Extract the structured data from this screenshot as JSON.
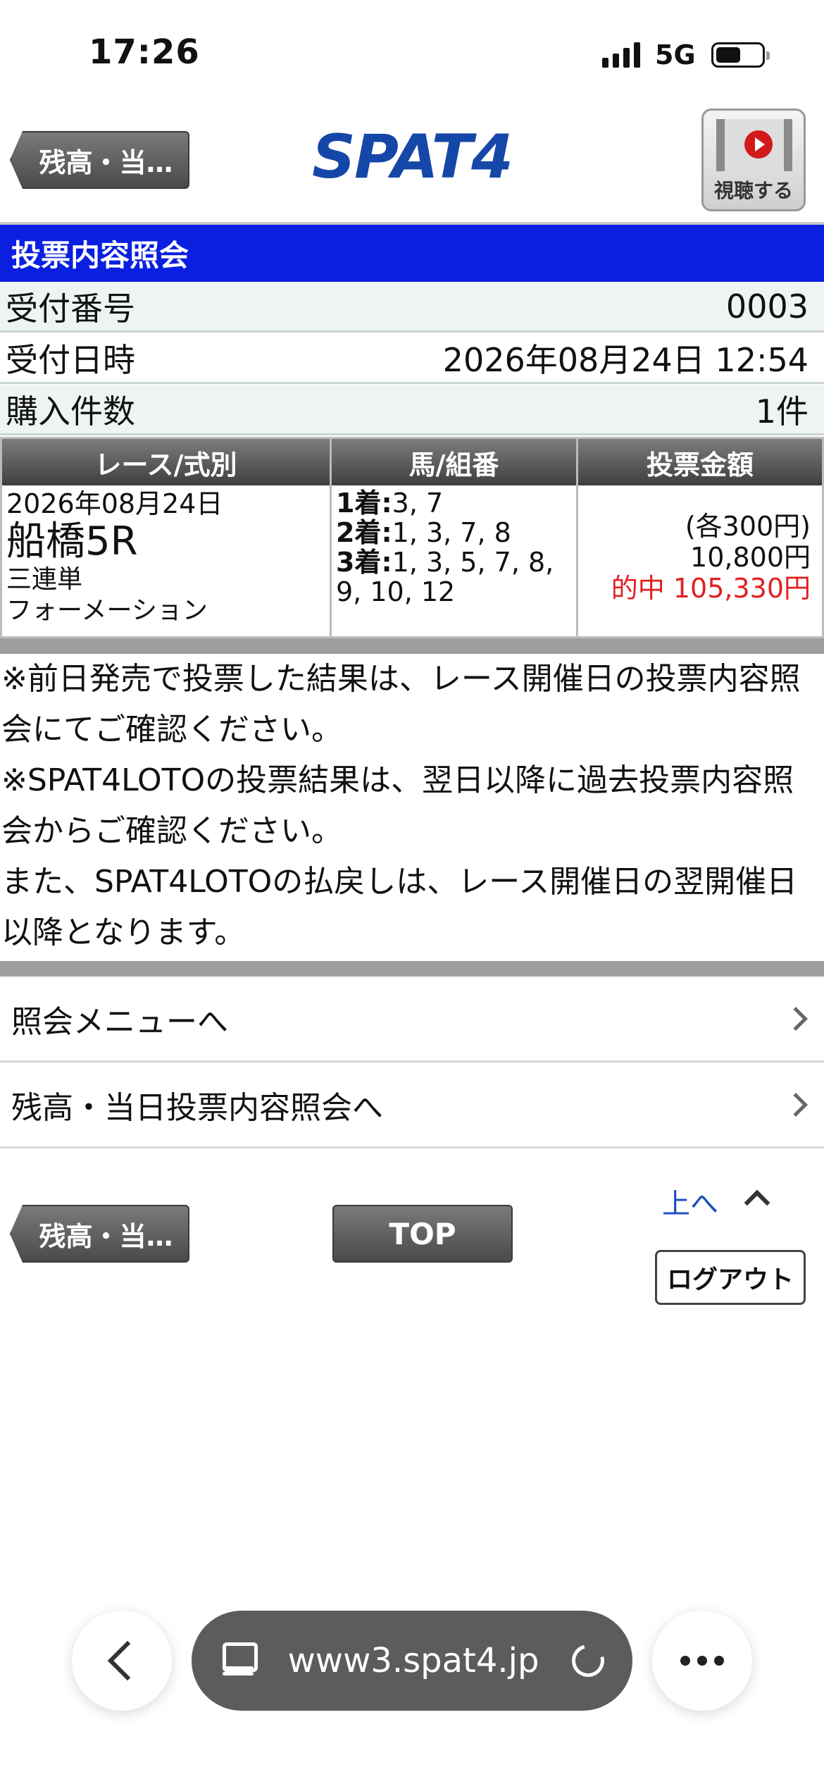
{
  "status_bar": {
    "time": "17:26",
    "network": "5G"
  },
  "header": {
    "back_label": "残高・当…",
    "logo_text": "SPAT4",
    "watch_label": "視聴する"
  },
  "page_title": "投票内容照会",
  "info": [
    {
      "label": "受付番号",
      "value": "0003"
    },
    {
      "label": "受付日時",
      "value": "2026年08月24日 12:54"
    },
    {
      "label": "購入件数",
      "value": "1件"
    }
  ],
  "table": {
    "headers": [
      "レース/式別",
      "馬/組番",
      "投票金額"
    ],
    "row": {
      "date": "2026年08月24日",
      "race": "船橋5R",
      "bet_type": "三連単",
      "method": "フォーメーション",
      "combos": [
        {
          "place": "1着:",
          "horses": "3, 7"
        },
        {
          "place": "2着:",
          "horses": "1, 3, 7, 8"
        },
        {
          "place": "3着:",
          "horses": "1, 3, 5, 7, 8, 9, 10, 12"
        }
      ],
      "unit": "(各300円)",
      "total": "10,800円",
      "hit_label": "的中",
      "payout": "105,330円"
    }
  },
  "notes": [
    "※前日発売で投票した結果は、レース開催日の投票内容照会にてご確認ください。",
    "※SPAT4LOTOの投票結果は、翌日以降に過去投票内容照会からご確認ください。",
    "また、SPAT4LOTOの払戻しは、レース開催日の翌開催日以降となります。"
  ],
  "menu": [
    {
      "label": "照会メニューへ"
    },
    {
      "label": "残高・当日投票内容照会へ"
    }
  ],
  "footer": {
    "back_label": "残高・当…",
    "top_label": "TOP",
    "up_label": "上へ",
    "logout_label": "ログアウト"
  },
  "browser": {
    "url": "www3.spat4.jp"
  },
  "colors": {
    "title_bar": "#0a1fe0",
    "hit": "#e02020",
    "logo": "#1447a8",
    "link": "#1f4fbf"
  }
}
